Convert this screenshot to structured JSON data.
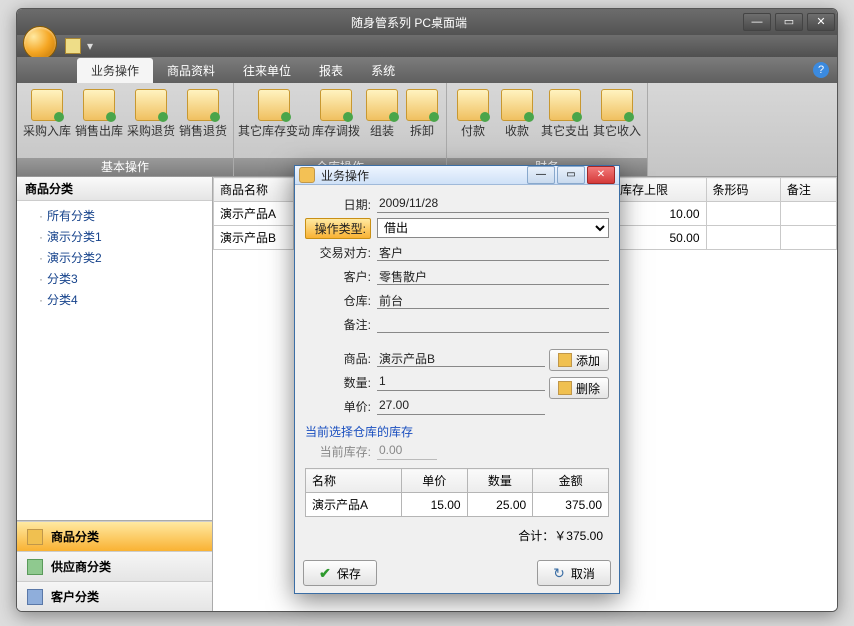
{
  "window": {
    "title": "随身管系列 PC桌面端"
  },
  "tabs": [
    "业务操作",
    "商品资料",
    "往来单位",
    "报表",
    "系统"
  ],
  "ribbon": {
    "groups": [
      {
        "title": "基本操作",
        "items": [
          "采购入库",
          "销售出库",
          "采购退货",
          "销售退货"
        ]
      },
      {
        "title": "仓库操作",
        "items": [
          "其它库存变动",
          "库存调拨",
          "组装",
          "拆卸"
        ]
      },
      {
        "title": "财务",
        "items": [
          "付款",
          "收款",
          "其它支出",
          "其它收入"
        ]
      }
    ]
  },
  "leftnav": {
    "header": "商品分类",
    "tree": [
      "所有分类",
      "演示分类1",
      "演示分类2",
      "分类3",
      "分类4"
    ],
    "stack": [
      "商品分类",
      "供应商分类",
      "客户分类"
    ]
  },
  "product_table": {
    "cols": [
      "商品名称",
      "库存上限",
      "条形码",
      "备注"
    ],
    "rows": [
      {
        "name": "演示产品A",
        "upper": "10.00",
        "barcode": "",
        "note": ""
      },
      {
        "name": "演示产品B",
        "upper": "50.00",
        "barcode": "",
        "note": ""
      }
    ]
  },
  "dialog": {
    "title": "业务操作",
    "form": {
      "date_label": "日期:",
      "date": "2009/11/28",
      "type_label": "操作类型:",
      "type": "借出",
      "party_label": "交易对方:",
      "party": "客户",
      "customer_label": "客户:",
      "customer": "零售散户",
      "warehouse_label": "仓库:",
      "warehouse": "前台",
      "note_label": "备注:",
      "note": "",
      "product_label": "商品:",
      "product": "演示产品B",
      "qty_label": "数量:",
      "qty": "1",
      "price_label": "单价:",
      "price": "27.00",
      "stock_header": "当前选择仓库的库存",
      "stock_label": "当前库存:",
      "stock": "0.00",
      "add_btn": "添加",
      "del_btn": "删除"
    },
    "items_cols": [
      "名称",
      "单价",
      "数量",
      "金额"
    ],
    "items": [
      {
        "name": "演示产品A",
        "price": "15.00",
        "qty": "25.00",
        "amount": "375.00"
      }
    ],
    "total_label": "合计：￥",
    "total": "375.00",
    "save_btn": "保存",
    "cancel_btn": "取消"
  }
}
